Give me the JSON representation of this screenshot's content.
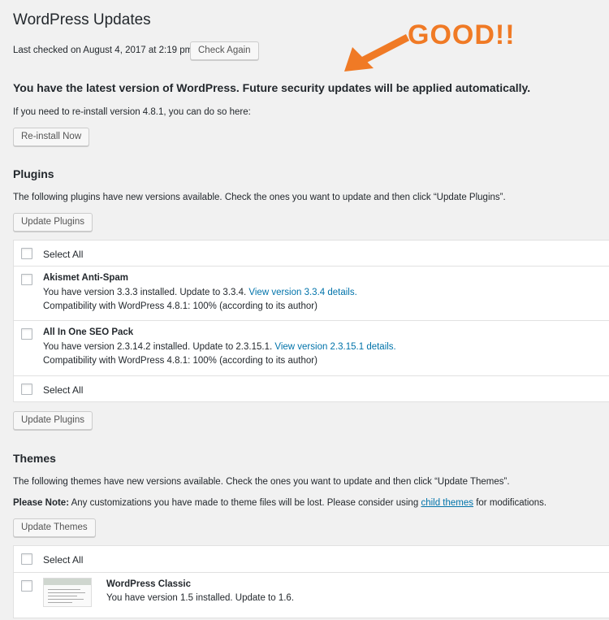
{
  "page": {
    "title": "WordPress Updates",
    "last_checked": "Last checked on August 4, 2017 at 2:19 pm.",
    "check_again_label": "Check Again"
  },
  "annotation": {
    "text": "GOOD!!",
    "color": "#f07a25",
    "arrow_icon": "arrow-icon"
  },
  "core": {
    "headline": "You have the latest version of WordPress. Future security updates will be applied automatically.",
    "reinstall_text": "If you need to re-install version 4.8.1, you can do so here:",
    "reinstall_label": "Re-install Now"
  },
  "plugins": {
    "heading": "Plugins",
    "intro": "The following plugins have new versions available. Check the ones you want to update and then click “Update Plugins”.",
    "update_label": "Update Plugins",
    "select_all": "Select All",
    "items": [
      {
        "name": "Akismet Anti-Spam",
        "version_text": "You have version 3.3.3 installed. Update to 3.3.4.",
        "details_link": "View version 3.3.4 details.",
        "compat": "Compatibility with WordPress 4.8.1: 100% (according to its author)"
      },
      {
        "name": "All In One SEO Pack",
        "version_text": "You have version 2.3.14.2 installed. Update to 2.3.15.1.",
        "details_link": "View version 2.3.15.1 details.",
        "compat": "Compatibility with WordPress 4.8.1: 100% (according to its author)"
      }
    ]
  },
  "themes": {
    "heading": "Themes",
    "intro": "The following themes have new versions available. Check the ones you want to update and then click “Update Themes”.",
    "note_label": "Please Note:",
    "note_text": "Any customizations you have made to theme files will be lost. Please consider using",
    "note_link": "child themes",
    "note_end": "for modifications.",
    "update_label": "Update Themes",
    "select_all": "Select All",
    "items": [
      {
        "name": "WordPress Classic",
        "version_text": "You have version 1.5 installed. Update to 1.6."
      }
    ]
  },
  "colors": {
    "link": "#0073aa",
    "background": "#f1f1f1",
    "accent_annotation": "#f07a25"
  }
}
